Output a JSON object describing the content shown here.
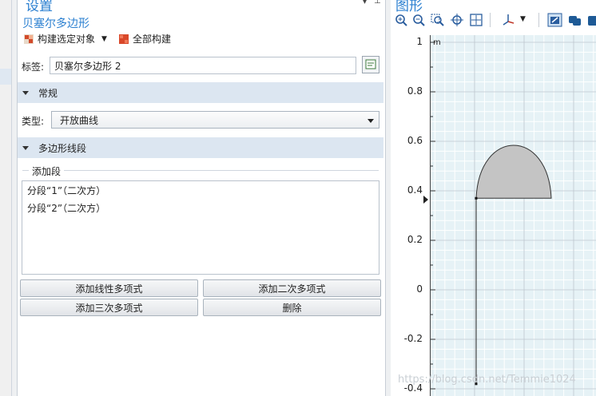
{
  "settings": {
    "header": "设置",
    "subtitle": "贝塞尔多边形",
    "build_selected": "构建选定对象",
    "build_all": "全部构建",
    "label_caption": "标签:",
    "label_value": "贝塞尔多边形 2"
  },
  "general": {
    "section_title": "常规",
    "type_caption": "类型:",
    "type_value": "开放曲线"
  },
  "segments": {
    "section_title": "多边形线段",
    "add_segment_legend": "添加段",
    "items": [
      "分段“1”（二次方）",
      "分段“2”（二次方）"
    ],
    "buttons": {
      "add_linear": "添加线性多项式",
      "add_quadratic": "添加二次多项式",
      "add_cubic": "添加三次多项式",
      "delete": "删除"
    }
  },
  "graphics": {
    "header": "图形",
    "unit": "m",
    "y_ticks": [
      "1",
      "0.8",
      "0.6",
      "0.4",
      "0.2",
      "0",
      "-0.2",
      "-0.4"
    ]
  },
  "chart_data": {
    "type": "line",
    "y_ticks": [
      1,
      0.8,
      0.6,
      0.4,
      0.2,
      0,
      -0.2,
      -0.4
    ],
    "ylim": [
      -0.4,
      1
    ],
    "grid": true,
    "unit": "m"
  },
  "watermark": "https://blog.csdn.net/Temmie1024"
}
